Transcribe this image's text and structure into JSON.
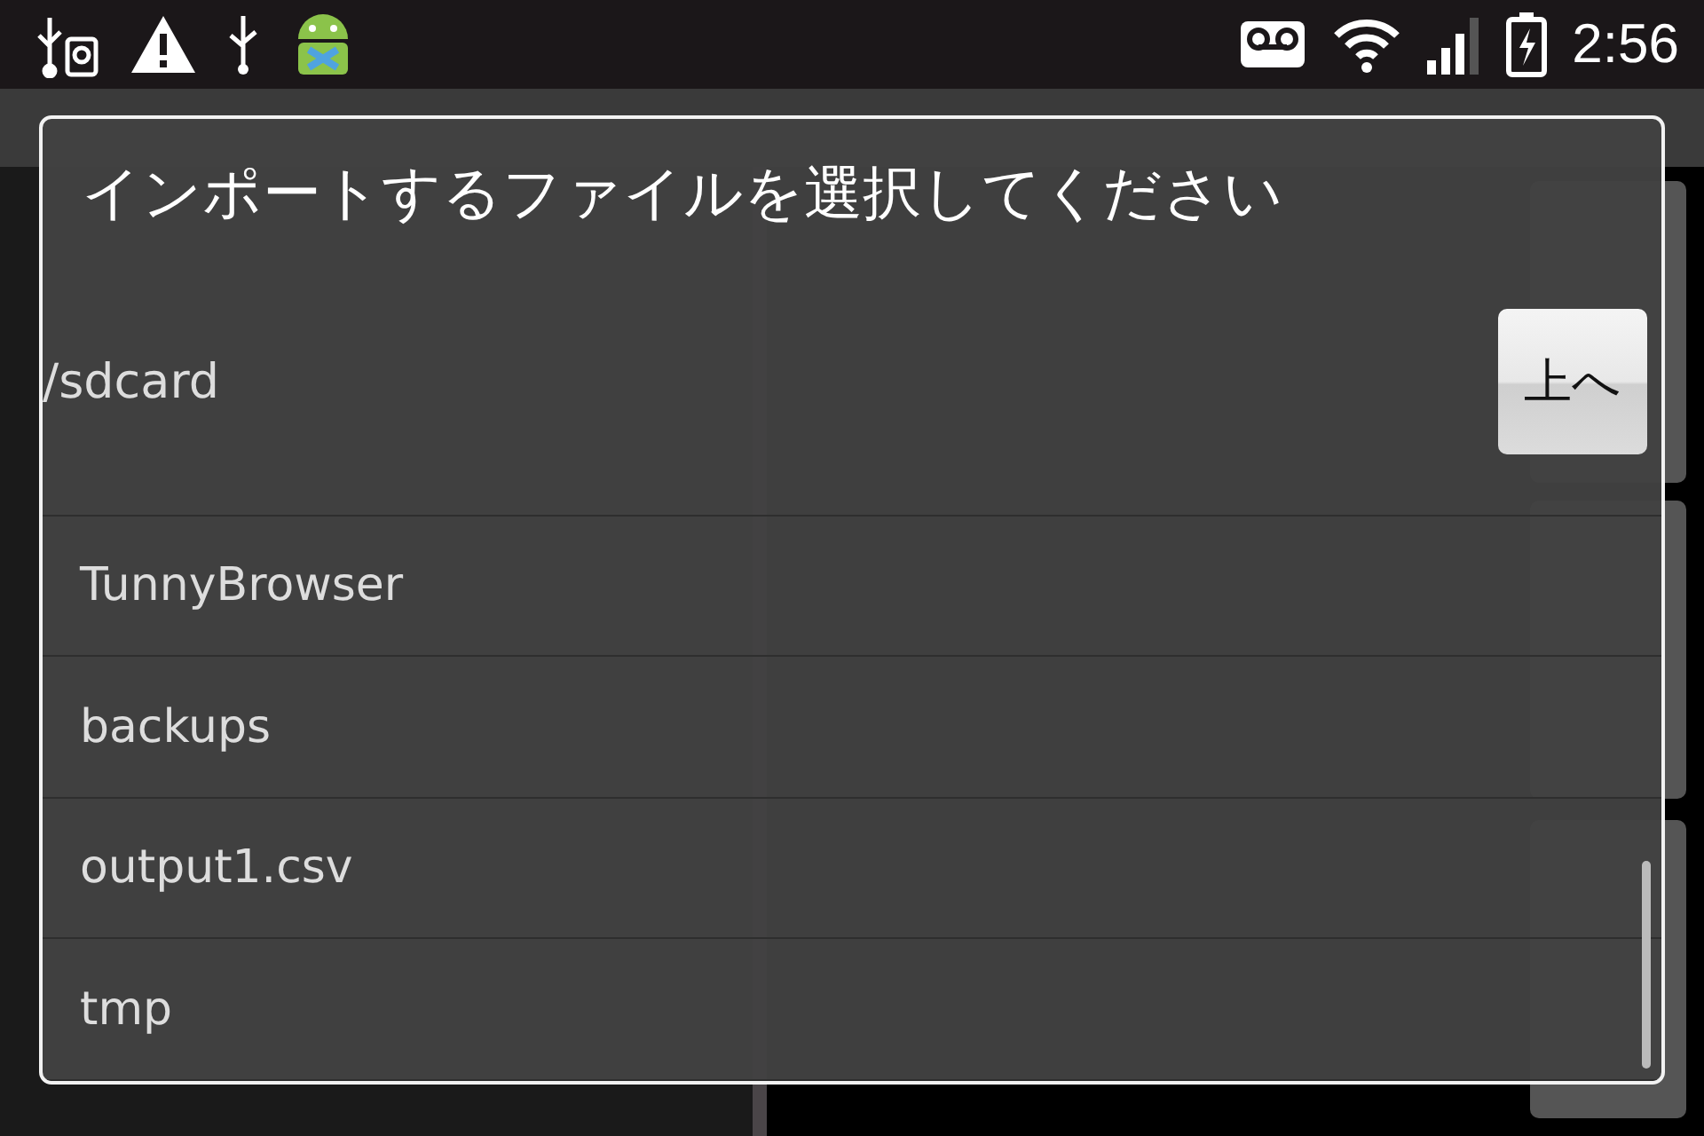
{
  "status_bar": {
    "time": "2:56"
  },
  "dialog": {
    "title": "インポートするファイルを選択してください",
    "path": "/sdcard",
    "up_button": "上へ",
    "files": [
      {
        "name": "TunnyBrowser"
      },
      {
        "name": "backups"
      },
      {
        "name": "output1.csv"
      },
      {
        "name": "tmp"
      }
    ]
  }
}
